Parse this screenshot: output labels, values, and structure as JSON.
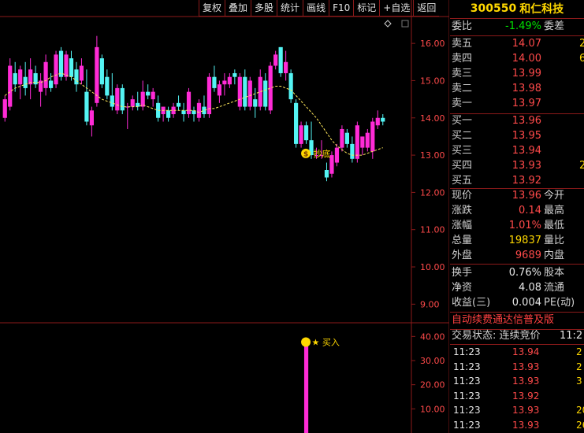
{
  "toolbar": {
    "items": [
      "复权",
      "叠加",
      "多股",
      "统计",
      "画线",
      "F10",
      "标记",
      "+自选",
      "返回"
    ]
  },
  "header_icon": "diamond-icon",
  "main_axis": {
    "ticks": [
      "16.00",
      "15.00",
      "14.00",
      "13.00",
      "12.00",
      "11.00",
      "10.00",
      "9.00"
    ]
  },
  "sub_axis": {
    "ticks": [
      "40.00",
      "30.00",
      "20.00",
      "10.00"
    ]
  },
  "annotations": {
    "bottom_signal": "抄底",
    "buy_signal": "★ 买入"
  },
  "chart_data": {
    "type": "candlestick",
    "price_ylim": [
      8.5,
      16.7
    ],
    "ma_line": "dashed yellow moving average",
    "candles": [
      {
        "o": 14.0,
        "h": 14.6,
        "l": 13.9,
        "c": 14.5
      },
      {
        "o": 14.3,
        "h": 15.6,
        "l": 14.2,
        "c": 15.4
      },
      {
        "o": 15.2,
        "h": 15.5,
        "l": 14.7,
        "c": 14.9
      },
      {
        "o": 14.9,
        "h": 15.4,
        "l": 14.5,
        "c": 15.3
      },
      {
        "o": 15.1,
        "h": 15.5,
        "l": 14.6,
        "c": 14.8
      },
      {
        "o": 14.9,
        "h": 15.6,
        "l": 14.5,
        "c": 15.3
      },
      {
        "o": 15.2,
        "h": 15.4,
        "l": 14.8,
        "c": 14.9
      },
      {
        "o": 14.7,
        "h": 15.2,
        "l": 14.3,
        "c": 15.0
      },
      {
        "o": 14.8,
        "h": 15.7,
        "l": 14.6,
        "c": 15.5
      },
      {
        "o": 15.0,
        "h": 15.2,
        "l": 14.7,
        "c": 14.8
      },
      {
        "o": 14.9,
        "h": 15.8,
        "l": 14.8,
        "c": 15.7
      },
      {
        "o": 15.8,
        "h": 15.9,
        "l": 15.0,
        "c": 15.1
      },
      {
        "o": 15.1,
        "h": 15.8,
        "l": 15.0,
        "c": 15.7
      },
      {
        "o": 15.6,
        "h": 15.8,
        "l": 15.0,
        "c": 15.1
      },
      {
        "o": 15.3,
        "h": 15.5,
        "l": 14.7,
        "c": 14.9
      },
      {
        "o": 15.0,
        "h": 15.6,
        "l": 14.9,
        "c": 15.4
      },
      {
        "o": 14.7,
        "h": 15.3,
        "l": 13.8,
        "c": 13.9
      },
      {
        "o": 13.8,
        "h": 14.3,
        "l": 13.5,
        "c": 14.2
      },
      {
        "o": 14.4,
        "h": 16.2,
        "l": 14.3,
        "c": 15.9
      },
      {
        "o": 15.6,
        "h": 15.7,
        "l": 14.8,
        "c": 14.9
      },
      {
        "o": 15.1,
        "h": 15.3,
        "l": 14.5,
        "c": 14.6
      },
      {
        "o": 14.6,
        "h": 15.2,
        "l": 14.2,
        "c": 14.3
      },
      {
        "o": 14.2,
        "h": 14.9,
        "l": 14.1,
        "c": 14.8
      },
      {
        "o": 14.8,
        "h": 14.9,
        "l": 14.1,
        "c": 14.2
      },
      {
        "o": 14.3,
        "h": 14.4,
        "l": 13.7,
        "c": 14.3
      },
      {
        "o": 14.3,
        "h": 14.6,
        "l": 14.2,
        "c": 14.5
      },
      {
        "o": 14.4,
        "h": 14.7,
        "l": 14.2,
        "c": 14.3
      },
      {
        "o": 14.3,
        "h": 15.0,
        "l": 14.2,
        "c": 14.7
      },
      {
        "o": 14.7,
        "h": 14.9,
        "l": 14.5,
        "c": 14.6
      },
      {
        "o": 14.5,
        "h": 14.8,
        "l": 14.3,
        "c": 14.7
      },
      {
        "o": 14.4,
        "h": 14.6,
        "l": 13.9,
        "c": 14.0
      },
      {
        "o": 14.1,
        "h": 14.3,
        "l": 13.9,
        "c": 14.3
      },
      {
        "o": 14.2,
        "h": 14.3,
        "l": 13.9,
        "c": 14.0
      },
      {
        "o": 14.1,
        "h": 14.4,
        "l": 14.0,
        "c": 14.3
      },
      {
        "o": 14.4,
        "h": 14.6,
        "l": 14.2,
        "c": 14.3
      },
      {
        "o": 14.2,
        "h": 14.4,
        "l": 13.9,
        "c": 14.1
      },
      {
        "o": 14.1,
        "h": 14.8,
        "l": 14.0,
        "c": 14.7
      },
      {
        "o": 14.2,
        "h": 14.3,
        "l": 13.9,
        "c": 14.1
      },
      {
        "o": 14.0,
        "h": 14.5,
        "l": 13.9,
        "c": 14.4
      },
      {
        "o": 14.3,
        "h": 14.6,
        "l": 14.0,
        "c": 14.1
      },
      {
        "o": 14.1,
        "h": 15.2,
        "l": 14.0,
        "c": 15.1
      },
      {
        "o": 15.1,
        "h": 15.4,
        "l": 14.7,
        "c": 14.8
      },
      {
        "o": 14.6,
        "h": 15.0,
        "l": 14.4,
        "c": 14.9
      },
      {
        "o": 14.9,
        "h": 15.2,
        "l": 14.6,
        "c": 15.0
      },
      {
        "o": 14.9,
        "h": 15.2,
        "l": 14.8,
        "c": 15.1
      },
      {
        "o": 15.2,
        "h": 15.3,
        "l": 14.9,
        "c": 15.1
      },
      {
        "o": 14.3,
        "h": 15.2,
        "l": 14.2,
        "c": 15.1
      },
      {
        "o": 15.1,
        "h": 15.3,
        "l": 14.2,
        "c": 14.3
      },
      {
        "o": 14.3,
        "h": 15.1,
        "l": 14.2,
        "c": 15.0
      },
      {
        "o": 14.5,
        "h": 14.8,
        "l": 14.0,
        "c": 14.3
      },
      {
        "o": 14.3,
        "h": 15.3,
        "l": 14.2,
        "c": 15.1
      },
      {
        "o": 15.0,
        "h": 15.2,
        "l": 14.2,
        "c": 14.3
      },
      {
        "o": 14.2,
        "h": 15.5,
        "l": 14.1,
        "c": 15.4
      },
      {
        "o": 15.4,
        "h": 15.8,
        "l": 15.3,
        "c": 15.7
      },
      {
        "o": 15.9,
        "h": 15.9,
        "l": 15.1,
        "c": 15.2
      },
      {
        "o": 15.2,
        "h": 15.8,
        "l": 15.0,
        "c": 15.5
      },
      {
        "o": 15.2,
        "h": 15.3,
        "l": 14.4,
        "c": 14.5
      },
      {
        "o": 14.4,
        "h": 14.5,
        "l": 13.2,
        "c": 13.3
      },
      {
        "o": 13.3,
        "h": 13.9,
        "l": 13.2,
        "c": 13.8
      },
      {
        "o": 13.8,
        "h": 13.9,
        "l": 13.3,
        "c": 13.4
      },
      {
        "o": 13.4,
        "h": 13.9,
        "l": 12.9,
        "c": 13.0
      },
      {
        "o": 13.0,
        "h": 13.2,
        "l": 12.9,
        "c": 13.0
      },
      {
        "o": 13.0,
        "h": 13.4,
        "l": 12.9,
        "c": 13.0
      },
      {
        "o": 12.6,
        "h": 12.8,
        "l": 12.3,
        "c": 12.4
      },
      {
        "o": 12.5,
        "h": 13.1,
        "l": 12.4,
        "c": 13.0
      },
      {
        "o": 12.8,
        "h": 13.3,
        "l": 12.7,
        "c": 13.2
      },
      {
        "o": 13.2,
        "h": 13.8,
        "l": 13.1,
        "c": 13.7
      },
      {
        "o": 13.6,
        "h": 13.7,
        "l": 13.2,
        "c": 13.3
      },
      {
        "o": 13.3,
        "h": 13.5,
        "l": 12.8,
        "c": 12.9
      },
      {
        "o": 12.9,
        "h": 13.9,
        "l": 12.8,
        "c": 13.8
      },
      {
        "o": 13.2,
        "h": 13.5,
        "l": 13.0,
        "c": 13.5
      },
      {
        "o": 13.2,
        "h": 13.7,
        "l": 13.1,
        "c": 13.6
      },
      {
        "o": 13.1,
        "h": 14.0,
        "l": 12.9,
        "c": 13.9
      },
      {
        "o": 13.8,
        "h": 14.2,
        "l": 13.7,
        "c": 14.0
      },
      {
        "o": 14.0,
        "h": 14.1,
        "l": 13.8,
        "c": 13.9
      }
    ],
    "ma": [
      14.6,
      14.7,
      14.8,
      14.85,
      14.9,
      14.95,
      14.95,
      14.95,
      15.0,
      15.1,
      15.15,
      15.2,
      15.15,
      15.1,
      15.0,
      14.9,
      14.8,
      14.7,
      14.6,
      14.5,
      14.45,
      14.4,
      14.35,
      14.3,
      14.3,
      14.3,
      14.3,
      14.35,
      14.3,
      14.25,
      14.2,
      14.2,
      14.2,
      14.2,
      14.2,
      14.2,
      14.2,
      14.2,
      14.15,
      14.2,
      14.25,
      14.25,
      14.3,
      14.35,
      14.4,
      14.45,
      14.5,
      14.55,
      14.6,
      14.65,
      14.7,
      14.75,
      14.8,
      14.85,
      14.85,
      14.8,
      14.75,
      14.6,
      14.45,
      14.3,
      14.15,
      14.0,
      13.8,
      13.6,
      13.4,
      13.25,
      13.15,
      13.05,
      13.0,
      13.0,
      13.0,
      13.05,
      13.1,
      13.15,
      13.2
    ],
    "volume_ylim": [
      0,
      45
    ],
    "volume_bar": {
      "index": 59,
      "value": 37
    },
    "bottom_signal_index": 59
  },
  "quote": {
    "code": "300550",
    "name": "和仁科技",
    "wei_bi_label": "委比",
    "wei_bi": "-1.49%",
    "wei_cha_label": "委差",
    "sell": [
      {
        "label": "卖五",
        "price": "14.07",
        "trunc": "2"
      },
      {
        "label": "卖四",
        "price": "14.00",
        "trunc": "6"
      },
      {
        "label": "卖三",
        "price": "13.99",
        "trunc": ""
      },
      {
        "label": "卖二",
        "price": "13.98",
        "trunc": ""
      },
      {
        "label": "卖一",
        "price": "13.97",
        "trunc": ""
      }
    ],
    "buy": [
      {
        "label": "买一",
        "price": "13.96",
        "trunc": ""
      },
      {
        "label": "买二",
        "price": "13.95",
        "trunc": ""
      },
      {
        "label": "买三",
        "price": "13.94",
        "trunc": ""
      },
      {
        "label": "买四",
        "price": "13.93",
        "trunc": "2"
      },
      {
        "label": "买五",
        "price": "13.92",
        "trunc": ""
      }
    ],
    "stats": [
      {
        "label": "现价",
        "value": "13.96",
        "tail": "今开"
      },
      {
        "label": "涨跌",
        "value": "0.14",
        "tail": "最高"
      },
      {
        "label": "涨幅",
        "value": "1.01%",
        "tail": "最低"
      },
      {
        "label": "总量",
        "value": "19837",
        "tail": "量比"
      },
      {
        "label": "外盘",
        "value": "9689",
        "tail": "内盘"
      }
    ],
    "fundamentals": [
      {
        "label": "换手",
        "value": "0.76%",
        "tail": "股本"
      },
      {
        "label": "净资",
        "value": "4.08",
        "tail": "流通"
      },
      {
        "label": "收益(三)",
        "value": "0.004",
        "tail": "PE(动)"
      }
    ],
    "banner": "自动续费通达信普及版",
    "trade_status_label": "交易状态: 连续竞价",
    "trade_status_time": "11:2",
    "ticks": [
      {
        "time": "11:23",
        "price": "13.94",
        "vol": "2"
      },
      {
        "time": "11:23",
        "price": "13.93",
        "vol": "2"
      },
      {
        "time": "11:23",
        "price": "13.93",
        "vol": "3"
      },
      {
        "time": "11:23",
        "price": "13.92",
        "vol": ""
      },
      {
        "time": "11:23",
        "price": "13.93",
        "vol": "20"
      },
      {
        "time": "11:23",
        "price": "13.93",
        "vol": "26"
      }
    ]
  },
  "colors": {
    "up": "#ff2bd6",
    "down": "#54f4f4",
    "ma": "#ffe85a",
    "axis": "#8b1a1a",
    "axis_text": "#ff4a4a",
    "volume": "#ff2bd6"
  }
}
